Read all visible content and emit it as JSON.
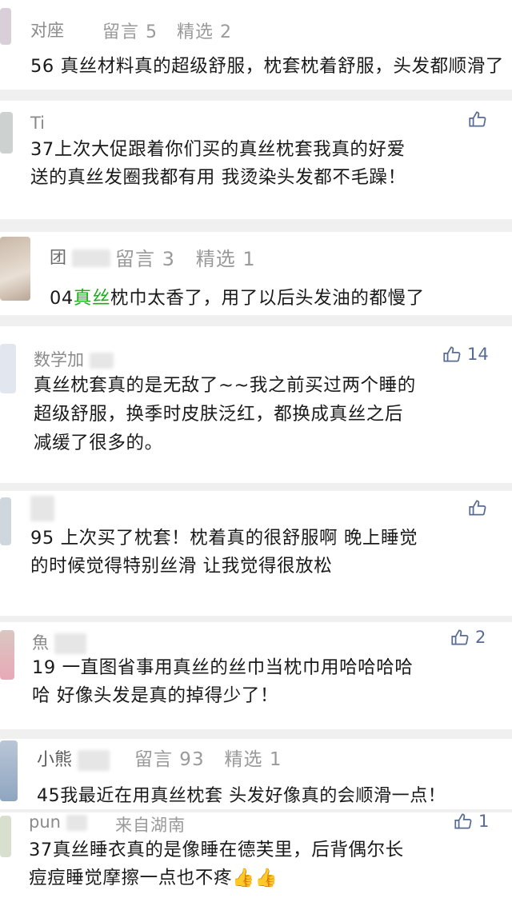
{
  "comments": [
    {
      "name": "对座",
      "meta": {
        "messages": "留言 5",
        "featured": "精选 2"
      },
      "text": [
        "56 真丝材料真的超级舒服，枕套枕着舒服，头发都顺滑了"
      ]
    },
    {
      "name": "Ti",
      "like": "",
      "text": [
        "37上次大促跟着你们买的真丝枕套我真的好爱",
        "送的真丝发圈我都有用 我烫染头发都不毛躁！"
      ]
    },
    {
      "name": "团",
      "meta": {
        "messages": "留言 3",
        "featured": "精选 1"
      },
      "text_prefix": "04",
      "text_highlight": "真丝",
      "text_rest": "枕巾太香了，用了以后头发油的都慢了"
    },
    {
      "name": "数学加",
      "like": "14",
      "text": [
        "真丝枕套真的是无敌了~~我之前买过两个睡的",
        "超级舒服，换季时皮肤泛红，都换成真丝之后",
        "减缓了很多的。"
      ]
    },
    {
      "name": "",
      "like": "",
      "text": [
        "95 上次买了枕套！枕着真的很舒服啊 晚上睡觉",
        "的时候觉得特别丝滑 让我觉得很放松"
      ]
    },
    {
      "name": "魚",
      "like": "2",
      "text": [
        "19 一直图省事用真丝的丝巾当枕巾用哈哈哈哈",
        "哈 好像头发是真的掉得少了！"
      ]
    },
    {
      "name": "小熊",
      "meta": {
        "messages": "留言 93",
        "featured": "精选 1"
      },
      "text": [
        "45我最近在用真丝枕套 头发好像真的会顺滑一点！"
      ]
    },
    {
      "name": "pun",
      "location": "来自湖南",
      "like": "1",
      "text": [
        "37真丝睡衣真的是像睡在德芙里，后背偶尔长",
        "痘痘睡觉摩擦一点也不疼👍👍"
      ]
    }
  ],
  "colors": {
    "highlight": "#1aad19",
    "like": "#576b95",
    "meta": "#9a9a9a",
    "separator": "#f0f0f0"
  },
  "icons": {
    "like": "thumbs-up-icon"
  }
}
